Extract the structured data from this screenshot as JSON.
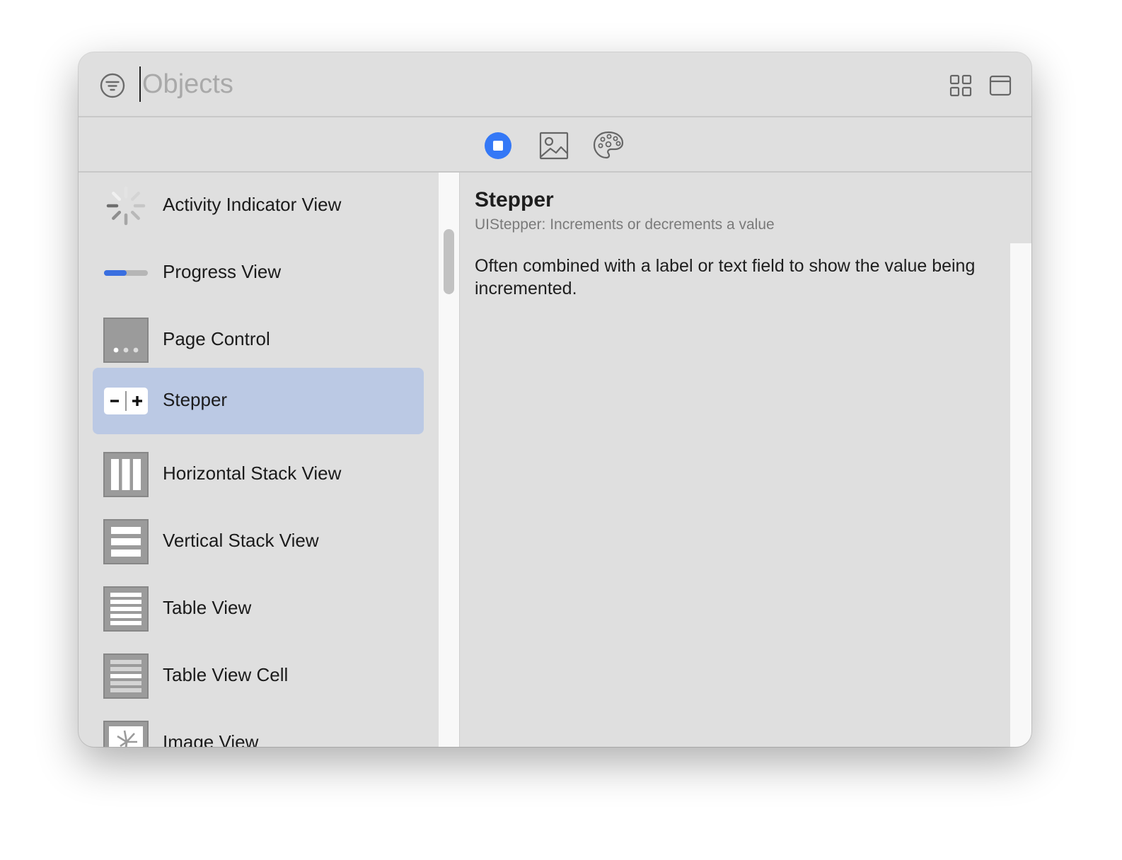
{
  "header": {
    "search_placeholder": "Objects",
    "filter_icon": "filter-icon",
    "grid_icon": "grid-view-icon",
    "window_icon": "window-icon"
  },
  "toolbar": {
    "tabs": [
      {
        "icon": "objects-tab-icon",
        "selected": true
      },
      {
        "icon": "media-image-icon",
        "selected": false
      },
      {
        "icon": "palette-icon",
        "selected": false
      }
    ],
    "accent_color": "#3478f6"
  },
  "library": {
    "items": [
      {
        "label": "Activity Indicator View",
        "icon": "activity-indicator-icon"
      },
      {
        "label": "Progress View",
        "icon": "progress-view-icon"
      },
      {
        "label": "Page Control",
        "icon": "page-control-icon"
      },
      {
        "label": "Stepper",
        "icon": "stepper-icon",
        "selected": true
      },
      {
        "label": "Horizontal Stack View",
        "icon": "horizontal-stack-icon"
      },
      {
        "label": "Vertical Stack View",
        "icon": "vertical-stack-icon"
      },
      {
        "label": "Table View",
        "icon": "table-view-icon"
      },
      {
        "label": "Table View Cell",
        "icon": "table-view-cell-icon"
      },
      {
        "label": "Image View",
        "icon": "image-view-icon"
      }
    ],
    "selection_color": "#bbc9e4"
  },
  "detail": {
    "title": "Stepper",
    "subtitle": "UIStepper: Increments or decrements a value",
    "description": "Often combined with a label or text field to show the value being incremented."
  }
}
